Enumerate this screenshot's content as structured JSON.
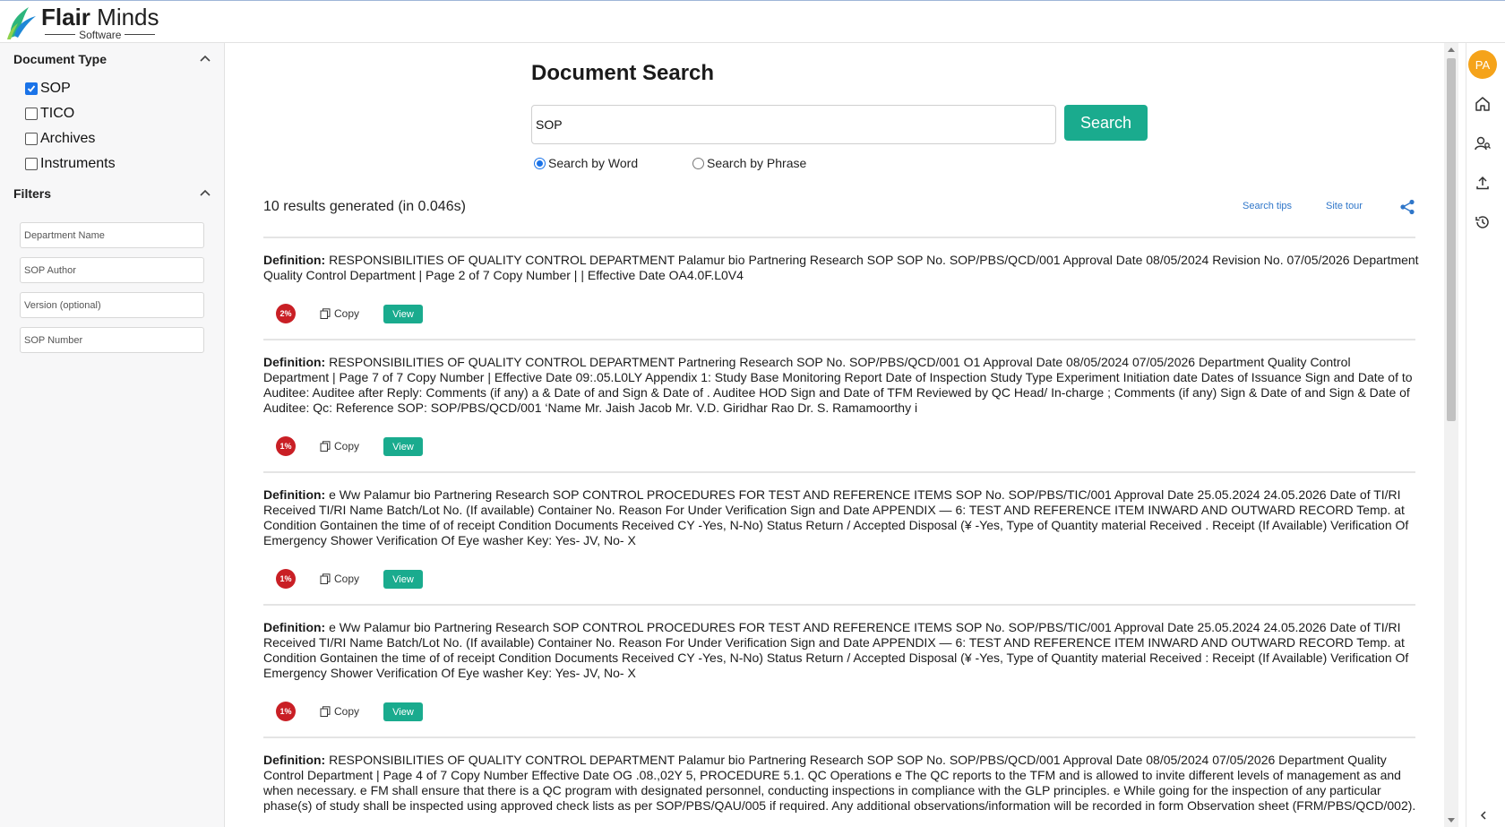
{
  "brand": {
    "name_bold": "Flair",
    "name_light": "Minds",
    "tagline": "Software"
  },
  "sidebar": {
    "document_type_heading": "Document Type",
    "document_types": [
      {
        "label": "SOP",
        "checked": true
      },
      {
        "label": "TICO",
        "checked": false
      },
      {
        "label": "Archives",
        "checked": false
      },
      {
        "label": "Instruments",
        "checked": false
      }
    ],
    "filters_heading": "Filters",
    "filter_placeholders": [
      "Department Name",
      "SOP Author",
      "Version (optional)",
      "SOP Number"
    ]
  },
  "main": {
    "title": "Document Search",
    "search": {
      "value": "SOP",
      "button_label": "Search"
    },
    "search_modes": [
      {
        "label": "Search by Word",
        "selected": true
      },
      {
        "label": "Search by Phrase",
        "selected": false
      }
    ],
    "results_summary": "10 results generated (in 0.046s)",
    "links": {
      "search_tips": "Search tips",
      "site_tour": "Site tour"
    },
    "copy_label": "Copy",
    "view_label": "View",
    "definition_label": "Definition:",
    "results": [
      {
        "score": "2%",
        "text": "RESPONSIBILITIES OF QUALITY CONTROL DEPARTMENT Palamur bio Partnering Research SOP SOP No. SOP/PBS/QCD/001 Approval Date 08/05/2024 Revision No. 07/05/2026 Department Quality Control Department | Page 2 of 7 Copy Number | | Effective Date OA4.0F.L0V4"
      },
      {
        "score": "1%",
        "text": "RESPONSIBILITIES OF QUALITY CONTROL DEPARTMENT Partnering Research SOP No. SOP/PBS/QCD/001 O1 Approval Date 08/05/2024 07/05/2026 Department Quality Control Department | Page 7 of 7 Copy Number | Effective Date 09:.05.L0LY Appendix 1: Study Base Monitoring Report Date of Inspection Study Type Experiment Initiation date Dates of Issuance Sign and Date of to Auditee: Auditee after Reply: Comments (if any) a & Date of and Sign & Date of . Auditee HOD Sign and Date of TFM Reviewed by QC Head/ In-charge ; Comments (if any) Sign & Date of and Sign & Date of Auditee: Qc: Reference SOP: SOP/PBS/QCD/001 ‘Name Mr. Jaish Jacob Mr. V.D. Giridhar Rao Dr. S. Ramamoorthy i"
      },
      {
        "score": "1%",
        "text": "e Ww Palamur bio Partnering Research SOP CONTROL PROCEDURES FOR TEST AND REFERENCE ITEMS SOP No. SOP/PBS/TIC/001 Approval Date 25.05.2024 24.05.2026 Date of TI/RI Received TI/RI Name Batch/Lot No. (If available) Container No. Reason For Under Verification Sign and Date APPENDIX — 6: TEST AND REFERENCE ITEM INWARD AND OUTWARD RECORD Temp. at Condition Gontainen the time of of receipt Condition Documents Received CY -Yes, N-No) Status Return / Accepted Disposal (¥ -Yes, Type of Quantity material Received . Receipt (If Available) Verification Of Emergency Shower Verification Of Eye washer Key: Yes- JV, No- X"
      },
      {
        "score": "1%",
        "text": "e Ww Palamur bio Partnering Research SOP CONTROL PROCEDURES FOR TEST AND REFERENCE ITEMS SOP No. SOP/PBS/TIC/001 Approval Date 25.05.2024 24.05.2026 Date of TI/RI Received TI/RI Name Batch/Lot No. (If available) Container No. Reason For Under Verification Sign and Date APPENDIX — 6: TEST AND REFERENCE ITEM INWARD AND OUTWARD RECORD Temp. at Condition Gontainen the time of of receipt Condition Documents Received CY -Yes, N-No) Status Return / Accepted Disposal (¥ -Yes, Type of Quantity material Received : Receipt (If Available) Verification Of Emergency Shower Verification Of Eye washer Key: Yes- JV, No- X"
      },
      {
        "score": "",
        "text": "RESPONSIBILITIES OF QUALITY CONTROL DEPARTMENT Palamur bio Partnering Research SOP SOP No. SOP/PBS/QCD/001 Approval Date 08/05/2024 07/05/2026 Department Quality Control Department | Page 4 of 7 Copy Number Effective Date OG .08.,02Y 5, PROCEDURE 5.1. QC Operations e The QC reports to the TFM and is allowed to invite different levels of management as and when necessary. e FM shall ensure that there is a QC program with designated personnel, conducting inspections in compliance with the GLP principles. e While going for the inspection of any particular phase(s) of study shall be inspected using approved check lists as per SOP/PBS/QAU/005 if required. Any additional observations/information will be recorded in form Observation sheet (FRM/PBS/QCD/002)."
      }
    ]
  },
  "rail": {
    "avatar_initials": "PA"
  },
  "colors": {
    "accent": "#1aab8e",
    "score_badge": "#c91f25",
    "avatar": "#f5a31a",
    "link": "#2f76c9"
  }
}
